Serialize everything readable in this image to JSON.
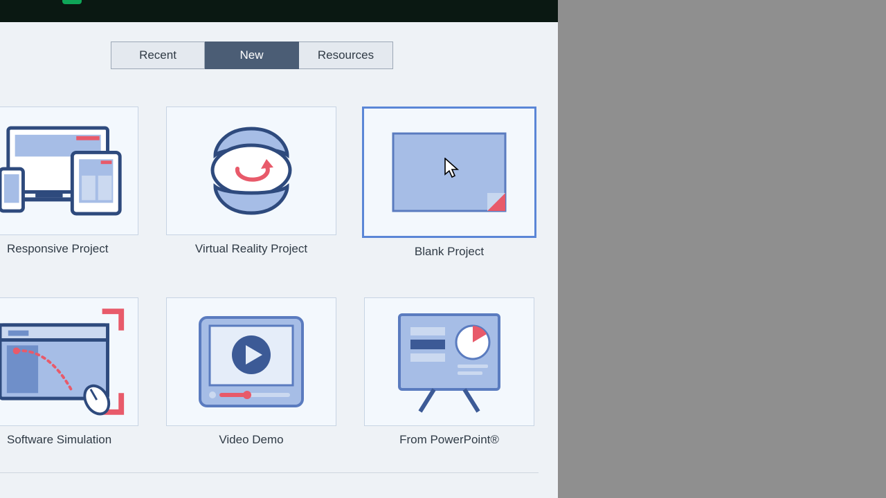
{
  "tabs": {
    "recent": "Recent",
    "new": "New",
    "resources": "Resources",
    "active": "new"
  },
  "tiles": {
    "responsive": "Responsive Project",
    "vr": "Virtual Reality Project",
    "blank": "Blank Project",
    "softsim": "Software Simulation",
    "videodemo": "Video Demo",
    "ppt": "From PowerPoint®"
  },
  "selected_tile": "blank"
}
